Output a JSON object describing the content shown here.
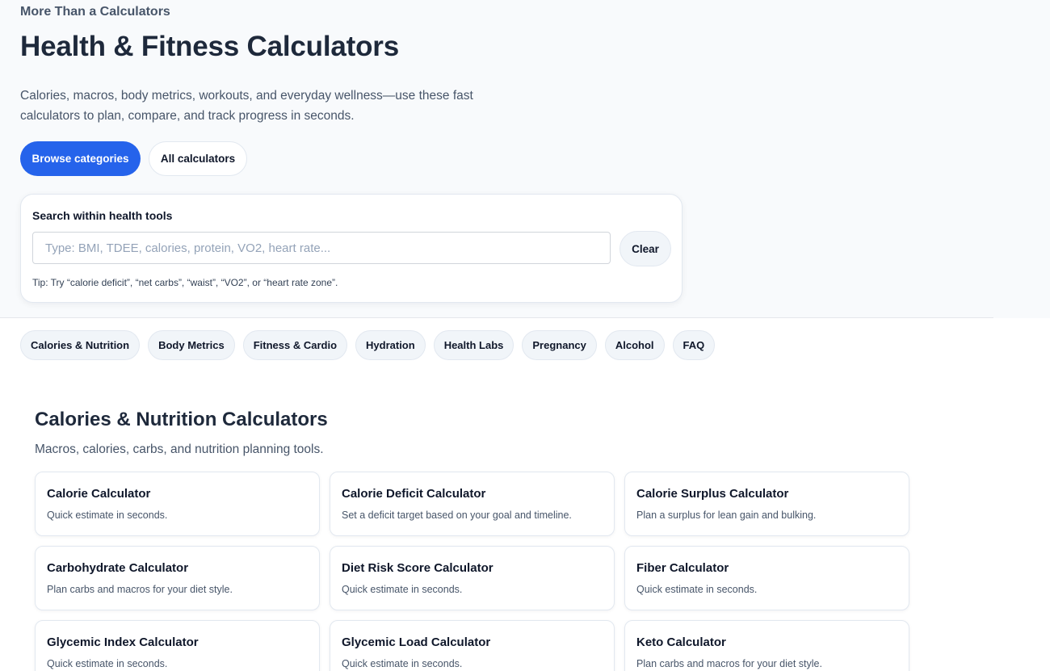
{
  "hero": {
    "kicker": "More Than a Calculators",
    "title": "Health & Fitness Calculators",
    "subtitle": "Calories, macros, body metrics, workouts, and everyday wellness—use these fast calculators to plan, compare, and track progress in seconds.",
    "browse_button": "Browse categories",
    "all_button": "All calculators"
  },
  "search": {
    "label": "Search within health tools",
    "placeholder": "Type: BMI, TDEE, calories, protein, VO2, heart rate...",
    "value": "",
    "clear_label": "Clear",
    "tip": "Tip: Try “calorie deficit”, “net carbs”, “waist”, “VO2”, or “heart rate zone”."
  },
  "categories": [
    {
      "label": "Calories & Nutrition"
    },
    {
      "label": "Body Metrics"
    },
    {
      "label": "Fitness & Cardio"
    },
    {
      "label": "Hydration"
    },
    {
      "label": "Health Labs"
    },
    {
      "label": "Pregnancy"
    },
    {
      "label": "Alcohol"
    },
    {
      "label": "FAQ"
    }
  ],
  "section": {
    "title": "Calories & Nutrition Calculators",
    "description": "Macros, calories, carbs, and nutrition planning tools."
  },
  "cards": [
    {
      "title": "Calorie Calculator",
      "desc": "Quick estimate in seconds."
    },
    {
      "title": "Calorie Deficit Calculator",
      "desc": "Set a deficit target based on your goal and timeline."
    },
    {
      "title": "Calorie Surplus Calculator",
      "desc": "Plan a surplus for lean gain and bulking."
    },
    {
      "title": "Carbohydrate Calculator",
      "desc": "Plan carbs and macros for your diet style."
    },
    {
      "title": "Diet Risk Score Calculator",
      "desc": "Quick estimate in seconds."
    },
    {
      "title": "Fiber Calculator",
      "desc": "Quick estimate in seconds."
    },
    {
      "title": "Glycemic Index Calculator",
      "desc": "Quick estimate in seconds."
    },
    {
      "title": "Glycemic Load Calculator",
      "desc": "Quick estimate in seconds."
    },
    {
      "title": "Keto Calculator",
      "desc": "Plan carbs and macros for your diet style."
    }
  ],
  "colors": {
    "accent": "#2563eb",
    "hero_background": "#f8fafc",
    "heading": "#1e293b"
  }
}
